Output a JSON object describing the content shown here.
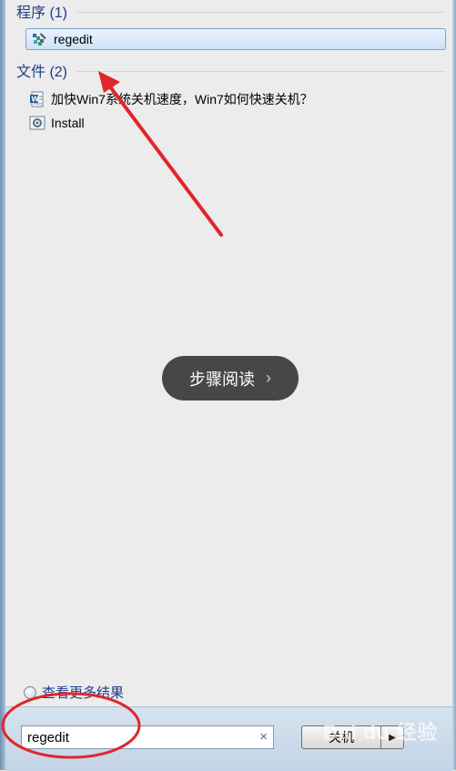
{
  "groups": {
    "programs": {
      "title": "程序 (1)",
      "items": [
        {
          "label": "regedit",
          "icon": "regedit-icon"
        }
      ]
    },
    "files": {
      "title": "文件 (2)",
      "items": [
        {
          "label": "加快Win7系统关机速度，Win7如何快速关机？",
          "icon": "word-document-icon"
        },
        {
          "label": "Install",
          "icon": "settings-file-icon"
        }
      ]
    }
  },
  "overlay": {
    "read_steps_label": "步骤阅读",
    "chevron": "›",
    "watermark": "Bai du 经验"
  },
  "footer": {
    "more_results_label": "查看更多结果",
    "search_value": "regedit",
    "clear_symbol": "×",
    "shutdown_label": "关机",
    "shutdown_arrow": "▶"
  },
  "colors": {
    "annotation_red": "#e0262b",
    "link_blue": "#1e3a8a",
    "selection_border": "#7da2ce"
  }
}
